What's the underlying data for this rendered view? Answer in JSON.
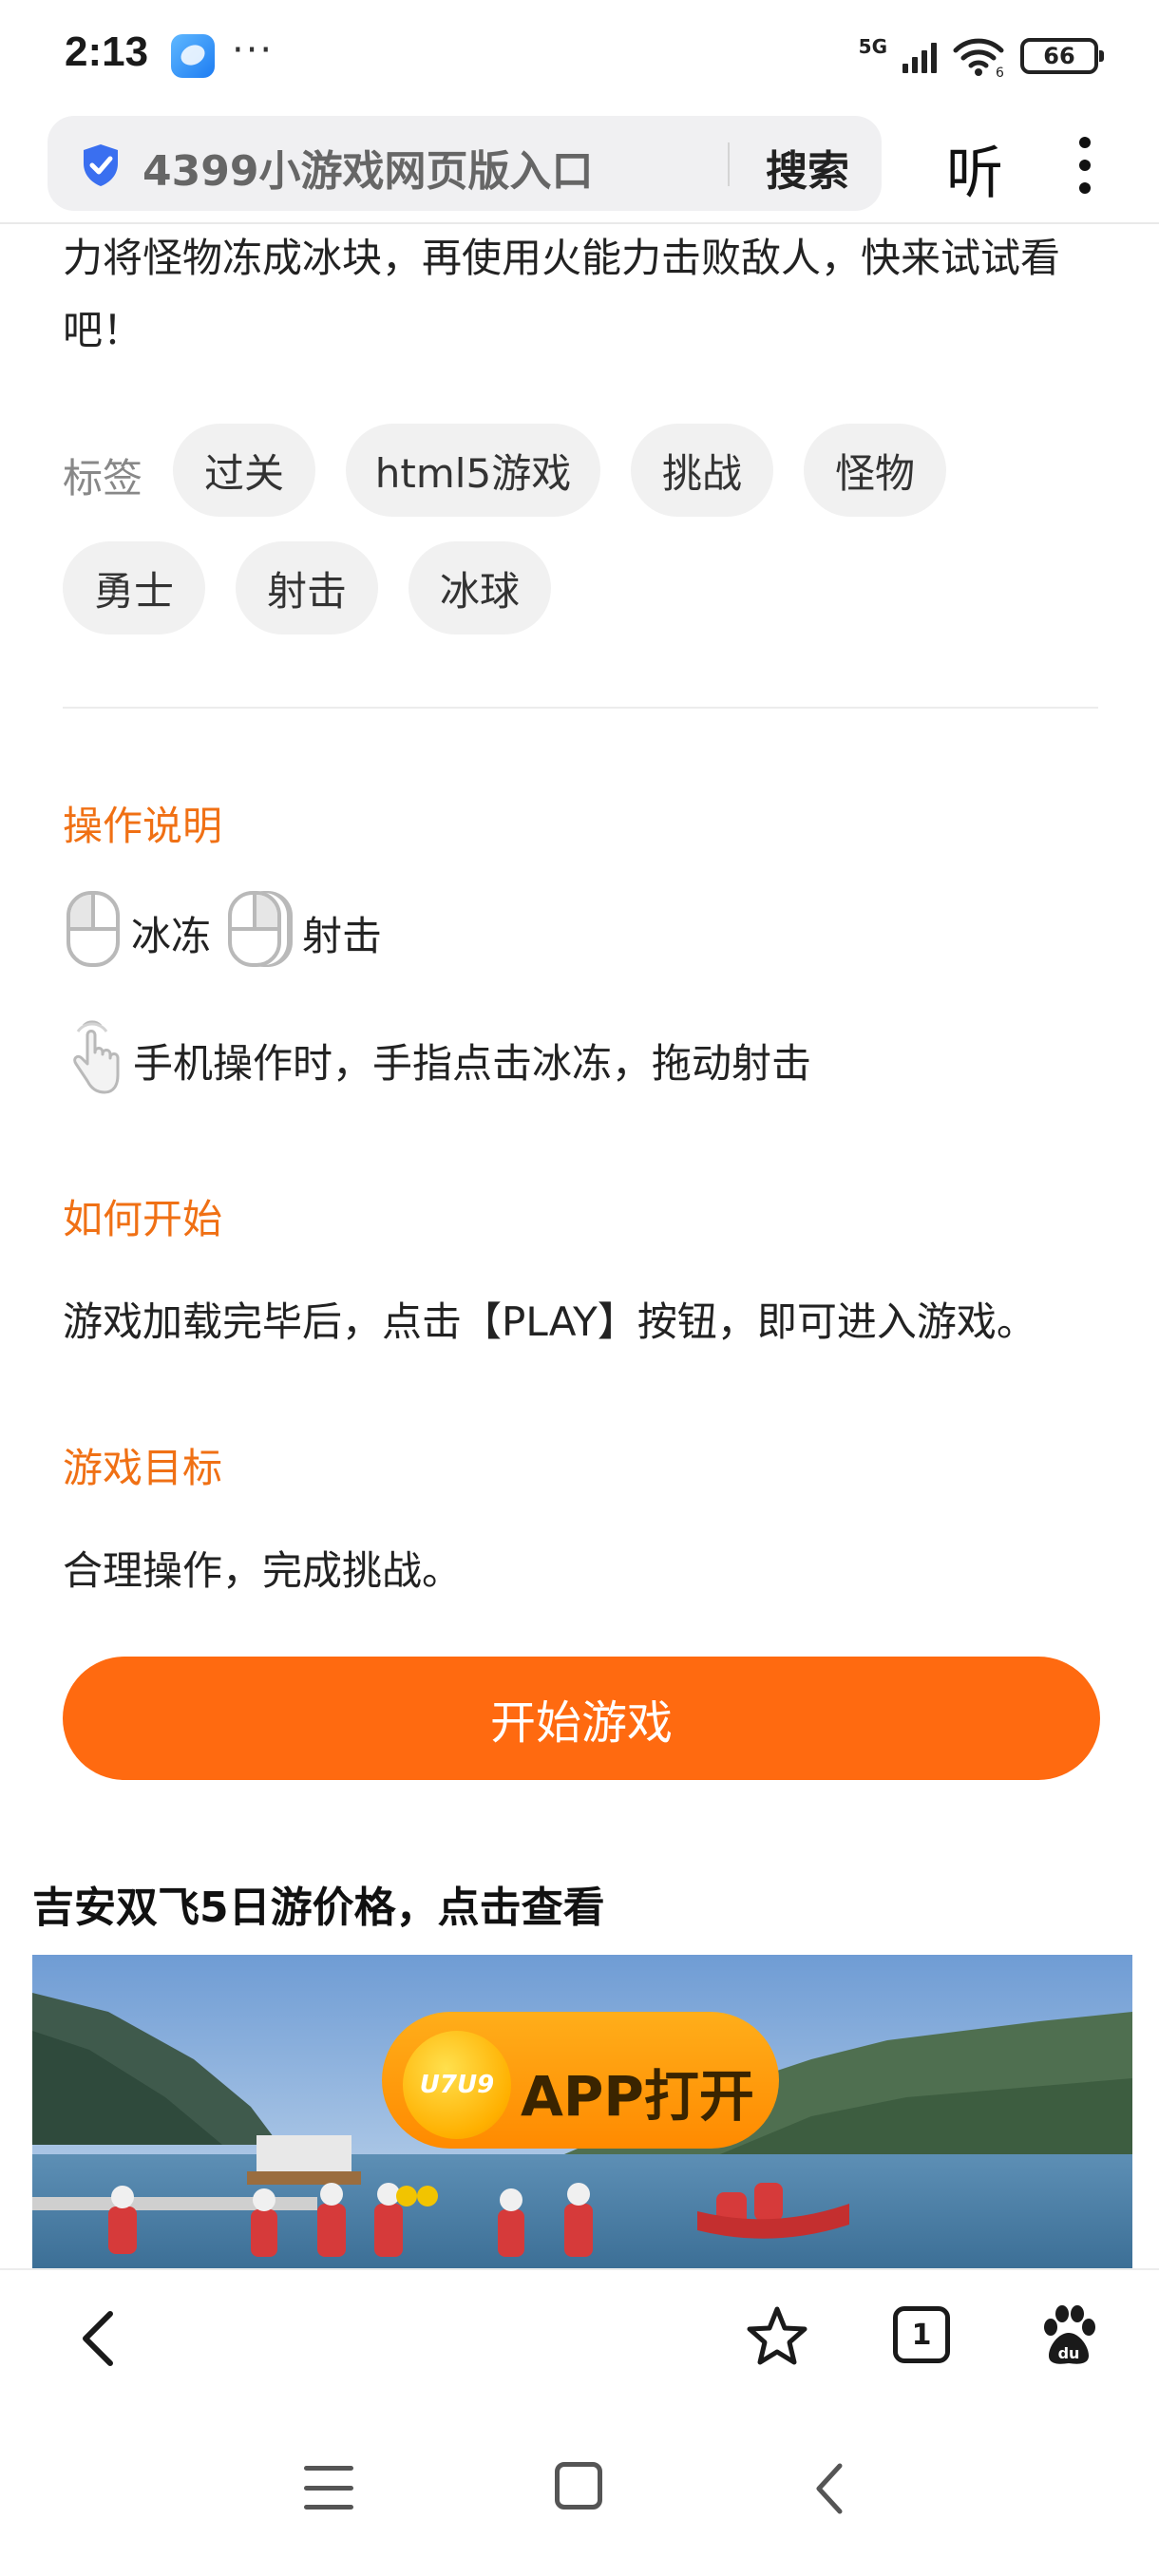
{
  "status_bar": {
    "time": "2:13",
    "dots": "···",
    "network": "5G",
    "wifi_sub": "6",
    "battery": "66"
  },
  "browser": {
    "address_text": "4399小游戏网页版入口",
    "search_label": "搜索",
    "listen_label": "听"
  },
  "game": {
    "description_line1": "力将怪物冻成冰块，再使用火能力击败敌人，快来试试看",
    "description_line2": "吧！",
    "tags_label": "标签",
    "tags": [
      "过关",
      "html5游戏",
      "挑战",
      "怪物",
      "勇士",
      "射击",
      "冰球"
    ],
    "controls_title": "操作说明",
    "control_left_label": "冰冻",
    "control_right_label": "射击",
    "touch_instruction": "手机操作时，手指点击冰冻，拖动射击",
    "how_to_start_title": "如何开始",
    "how_to_start_text": "游戏加载完毕后，点击【PLAY】按钮，即可进入游戏。",
    "goal_title": "游戏目标",
    "goal_text": "合理操作，完成挑战。",
    "start_button": "开始游戏"
  },
  "ad": {
    "title": "吉安双飞5日游价格，点击查看",
    "app_logo_text": "U7U9",
    "app_open_label": "APP打开"
  },
  "toolbar": {
    "tab_count": "1"
  },
  "colors": {
    "accent_orange": "#ff6a10",
    "section_title": "#f07014",
    "shield_blue": "#3a6ff0"
  }
}
